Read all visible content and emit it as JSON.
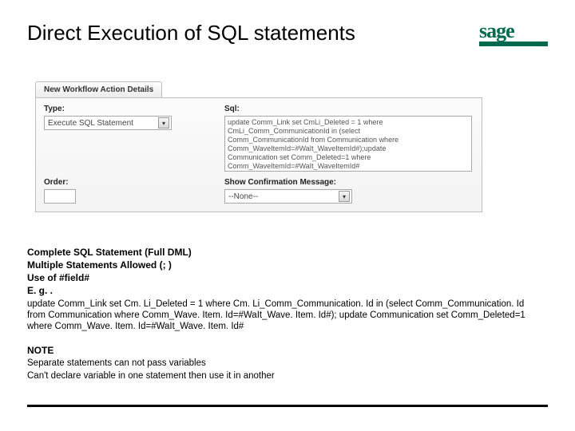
{
  "title": "Direct Execution of SQL statements",
  "logo": {
    "text": "sage"
  },
  "panel": {
    "tab": "New Workflow Action Details",
    "type_label": "Type:",
    "type_value": "Execute SQL Statement",
    "sql_label": "Sql:",
    "sql_value": "update Comm_Link set CmLi_Deleted = 1 where\nCmLi_Comm_CommunicationId in (select\nComm_CommunicationId from Communication where\nComm_WaveItemId=#WaIt_WaveItemId#);update\nCommunication set Comm_Deleted=1 where\nComm_WaveItemId=#WaIt_WaveItemId#",
    "order_label": "Order:",
    "confirm_label": "Show Confirmation Message:",
    "confirm_value": "--None--"
  },
  "notes": {
    "b1": "Complete SQL Statement (Full DML)",
    "b2": "Multiple Statements Allowed (; )",
    "b3": "Use of #field#",
    "b4": "E. g. .",
    "para": "update Comm_Link set Cm. Li_Deleted = 1 where Cm. Li_Comm_Communication. Id in (select Comm_Communication. Id from Communication where Comm_Wave. Item. Id=#WaIt_Wave. Item. Id#); update Communication set Comm_Deleted=1 where Comm_Wave. Item. Id=#WaIt_Wave. Item. Id#",
    "note_head": "NOTE",
    "note1": "Separate statements can not pass variables",
    "note2": "Can't declare variable in one statement then use it in another"
  }
}
